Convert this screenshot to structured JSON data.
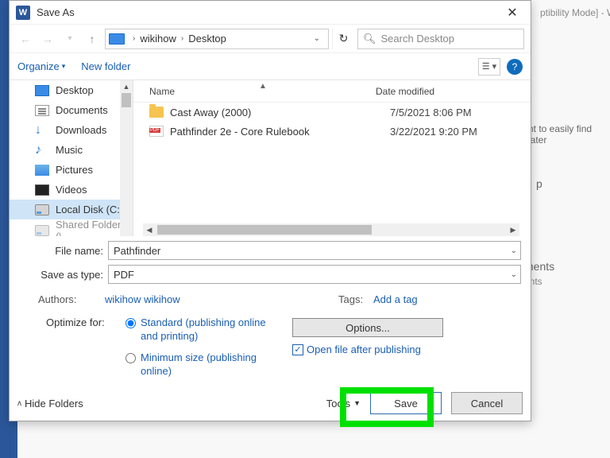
{
  "word_background": {
    "title_fragment": "ptibility Mode]  -  W",
    "text1": "nt to easily find later",
    "text2": "p",
    "text3": "ments",
    "text4": "ents"
  },
  "dialog": {
    "title": "Save As",
    "word_icon_label": "W"
  },
  "nav": {
    "breadcrumb": {
      "loc1": "wikihow",
      "loc2": "Desktop"
    },
    "search_placeholder": "Search Desktop"
  },
  "toolbar": {
    "organize": "Organize",
    "new_folder": "New folder"
  },
  "sidebar": {
    "items": [
      {
        "label": "Desktop"
      },
      {
        "label": "Documents"
      },
      {
        "label": "Downloads"
      },
      {
        "label": "Music"
      },
      {
        "label": "Pictures"
      },
      {
        "label": "Videos"
      },
      {
        "label": "Local Disk (C:)"
      },
      {
        "label": "Shared Folders (\\"
      }
    ]
  },
  "filelist": {
    "col_name": "Name",
    "col_date": "Date modified",
    "rows": [
      {
        "name": "Cast Away (2000)",
        "date": "7/5/2021 8:06 PM"
      },
      {
        "name": "Pathfinder 2e - Core Rulebook",
        "date": "3/22/2021 9:20 PM"
      }
    ]
  },
  "fields": {
    "filename_label": "File name:",
    "filename_value": "Pathfinder",
    "type_label": "Save as type:",
    "type_value": "PDF"
  },
  "meta": {
    "authors_label": "Authors:",
    "authors_value": "wikihow wikihow",
    "tags_label": "Tags:",
    "tags_value": "Add a tag"
  },
  "optimize": {
    "label": "Optimize for:",
    "standard": "Standard (publishing online and printing)",
    "minimum": "Minimum size (publishing online)",
    "options_btn": "Options...",
    "open_after": "Open file after publishing"
  },
  "footer": {
    "hide_folders": "Hide Folders",
    "tools": "Tools",
    "save": "Save",
    "cancel": "Cancel"
  }
}
